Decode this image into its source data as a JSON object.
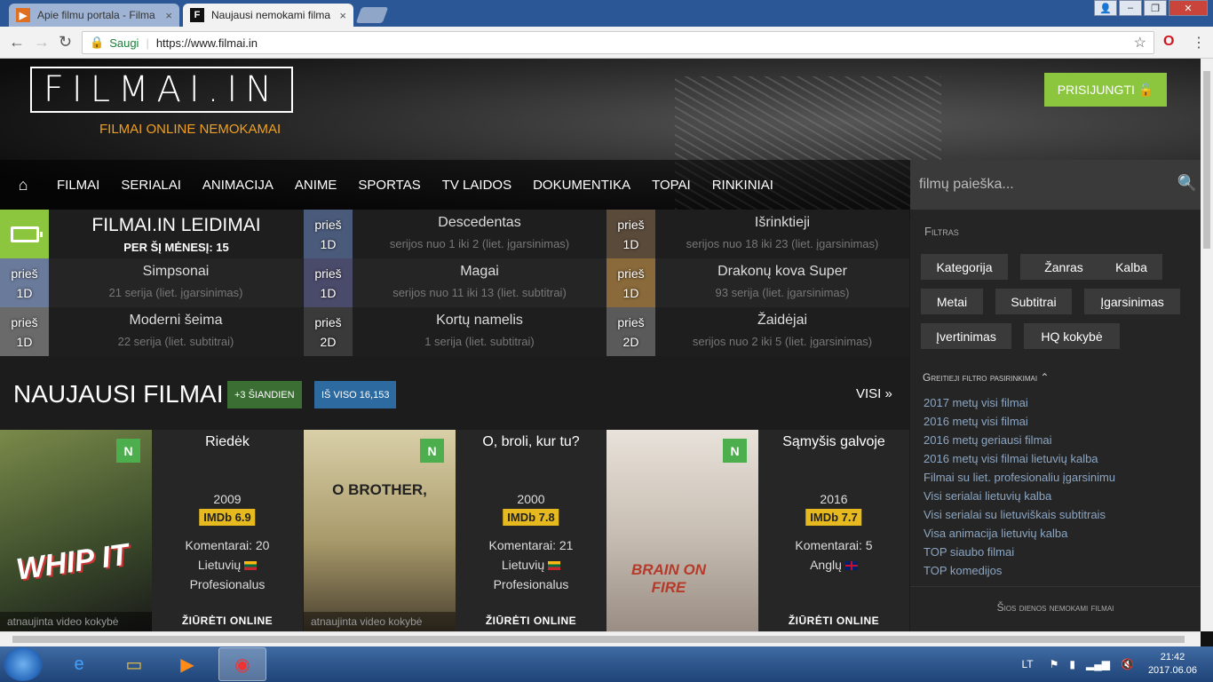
{
  "browser": {
    "tabs": [
      {
        "title": "Apie filmu portala - Filma",
        "active": false
      },
      {
        "title": "Naujausi nemokami filma",
        "active": true
      }
    ],
    "secure_label": "Saugi",
    "url": "https://www.filmai.in"
  },
  "site": {
    "logo": "FILMAI.IN",
    "tagline": "FILMAI ONLINE NEMOKAMAI",
    "login": "PRISIJUNGTI",
    "nav": [
      "FILMAI",
      "SERIALAI",
      "ANIMACIJA",
      "ANIME",
      "SPORTAS",
      "TV LAIDOS",
      "DOKUMENTIKA",
      "TOPAI",
      "RINKINIAI"
    ],
    "search_placeholder": "filmų paieška..."
  },
  "releases": {
    "title": "FILMAI.IN LEIDIMAI",
    "subtitle": "PER ŠĮ MĖNESĮ: 15",
    "items": [
      {
        "age1": "prieš",
        "age2": "1D",
        "title": "Descedentas",
        "sub": "serijos nuo 1 iki 2 (liet. įgarsinimas)",
        "color": "#4a5a7a"
      },
      {
        "age1": "prieš",
        "age2": "1D",
        "title": "Išrinktieji",
        "sub": "serijos nuo 18 iki 23 (liet. įgarsinimas)",
        "color": "#5a4a3a"
      },
      {
        "age1": "prieš",
        "age2": "1D",
        "title": "Simpsonai",
        "sub": "21 serija (liet. įgarsinimas)",
        "color": "#6a7a9a"
      },
      {
        "age1": "prieš",
        "age2": "1D",
        "title": "Magai",
        "sub": "serijos nuo 11 iki 13 (liet. subtitrai)",
        "color": "#4a4a6a"
      },
      {
        "age1": "prieš",
        "age2": "1D",
        "title": "Drakonų kova Super",
        "sub": "93 serija (liet. įgarsinimas)",
        "color": "#8a6a3a"
      },
      {
        "age1": "prieš",
        "age2": "1D",
        "title": "Moderni šeima",
        "sub": "22 serija (liet. subtitrai)",
        "color": "#6a6a6a"
      },
      {
        "age1": "prieš",
        "age2": "2D",
        "title": "Kortų namelis",
        "sub": "1 serija (liet. subtitrai)",
        "color": "#3a3a3a"
      },
      {
        "age1": "prieš",
        "age2": "2D",
        "title": "Žaidėjai",
        "sub": "serijos nuo 2 iki 5 (liet. įgarsinimas)",
        "color": "#5a5a5a"
      }
    ]
  },
  "newest": {
    "title": "NAUJAUSI FILMAI",
    "today": "+3 ŠIANDIEN",
    "total": "IŠ VISO 16,153",
    "all": "VISI »",
    "movies": [
      {
        "badge": "N",
        "title": "Riedėk",
        "year": "2009",
        "imdb": "IMDb 6.9",
        "comments": "Komentarai: 20",
        "lang": "Lietuvių",
        "flag": "lt",
        "type": "Profesionalus",
        "caption": "atnaujinta video kokybė",
        "watch": "ŽIŪRĖTI ONLINE",
        "poster_text": "WHIP IT",
        "poster_color": "#5a6a3a"
      },
      {
        "badge": "N",
        "title": "O, broli, kur tu?",
        "year": "2000",
        "imdb": "IMDb 7.8",
        "comments": "Komentarai: 21",
        "lang": "Lietuvių",
        "flag": "lt",
        "type": "Profesionalus",
        "caption": "atnaujinta video kokybė",
        "watch": "ŽIŪRĖTI ONLINE",
        "poster_text": "O BROTHER,",
        "poster_color": "#a89a6a"
      },
      {
        "badge": "N",
        "title": "Sąmyšis galvoje",
        "year": "2016",
        "imdb": "IMDb 7.7",
        "comments": "Komentarai: 5",
        "lang": "Anglų",
        "flag": "uk",
        "type": "",
        "caption": "",
        "watch": "ŽIŪRĖTI ONLINE",
        "poster_text": "BRAIN ON FIRE",
        "poster_color": "#cfc6bc"
      }
    ]
  },
  "sidebar": {
    "filter_title": "Filtras",
    "filters": [
      "Kategorija",
      "Žanras",
      "Kalba",
      "Metai",
      "Subtitrai",
      "Įgarsinimas",
      "Įvertinimas",
      "HQ kokybė"
    ],
    "quick_title": "Greitieji filtro pasirinkimai",
    "quick_links": [
      "2017 metų visi filmai",
      "2016 metų visi filmai",
      "2016 metų geriausi filmai",
      "2016 metų visi filmai lietuvių kalba",
      "Filmai su liet. profesionaliu įgarsinimu",
      "Visi serialai lietuvių kalba",
      "Visi serialai su lietuviškais subtitrais",
      "Visa animacija lietuvių kalba",
      "TOP siaubo filmai",
      "TOP komedijos"
    ],
    "daily_title": "Šios dienos nemokami filmai"
  },
  "taskbar": {
    "lang": "LT",
    "time": "21:42",
    "date": "2017.06.06"
  }
}
